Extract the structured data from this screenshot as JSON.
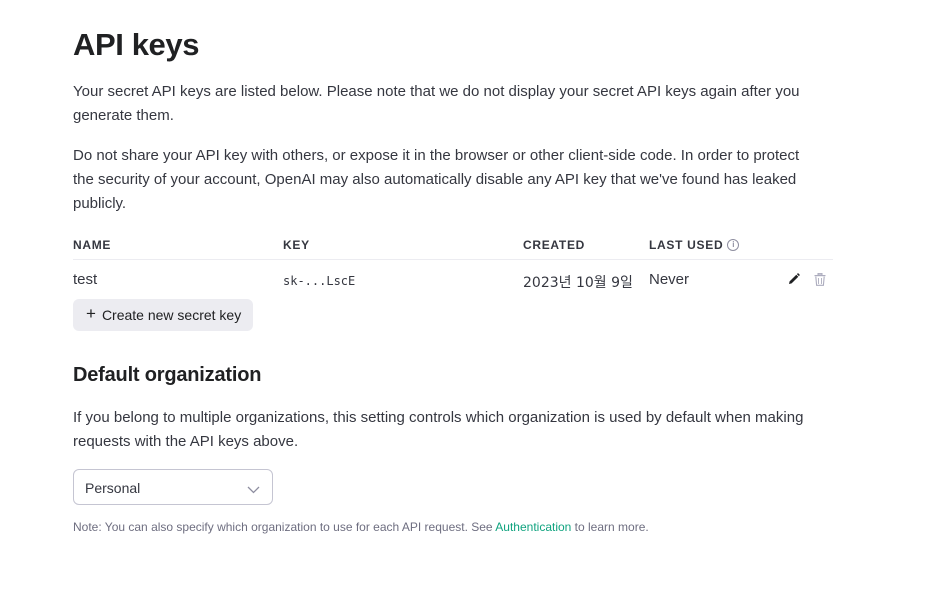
{
  "header": {
    "title": "API keys"
  },
  "intro": {
    "paragraph1": "Your secret API keys are listed below. Please note that we do not display your secret API keys again after you generate them.",
    "paragraph2": "Do not share your API key with others, or expose it in the browser or other client-side code. In order to protect the security of your account, OpenAI may also automatically disable any API key that we've found has leaked publicly."
  },
  "keys_table": {
    "columns": [
      "NAME",
      "KEY",
      "CREATED",
      "LAST USED"
    ],
    "rows": [
      {
        "name": "test",
        "key": "sk-...LscE",
        "created": "2023년 10월 9일",
        "last_used": "Never"
      }
    ],
    "row_action_icons": [
      "pencil-icon",
      "trash-icon"
    ],
    "info_icon": "info-icon"
  },
  "create_button": {
    "icon": "plus-icon",
    "label": "Create new secret key"
  },
  "default_org": {
    "title": "Default organization",
    "description": "If you belong to multiple organizations, this setting controls which organization is used by default when making requests with the API keys above.",
    "selected": "Personal",
    "note_prefix": "Note: You can also specify which organization to use for each API request. See ",
    "note_link": "Authentication",
    "note_suffix": " to learn more."
  },
  "colors": {
    "text_primary": "#202123",
    "text_body": "#353740",
    "text_muted": "#6e6e80",
    "link": "#10a37f",
    "button_bg": "#ececf1",
    "border": "#c5c5d2"
  }
}
